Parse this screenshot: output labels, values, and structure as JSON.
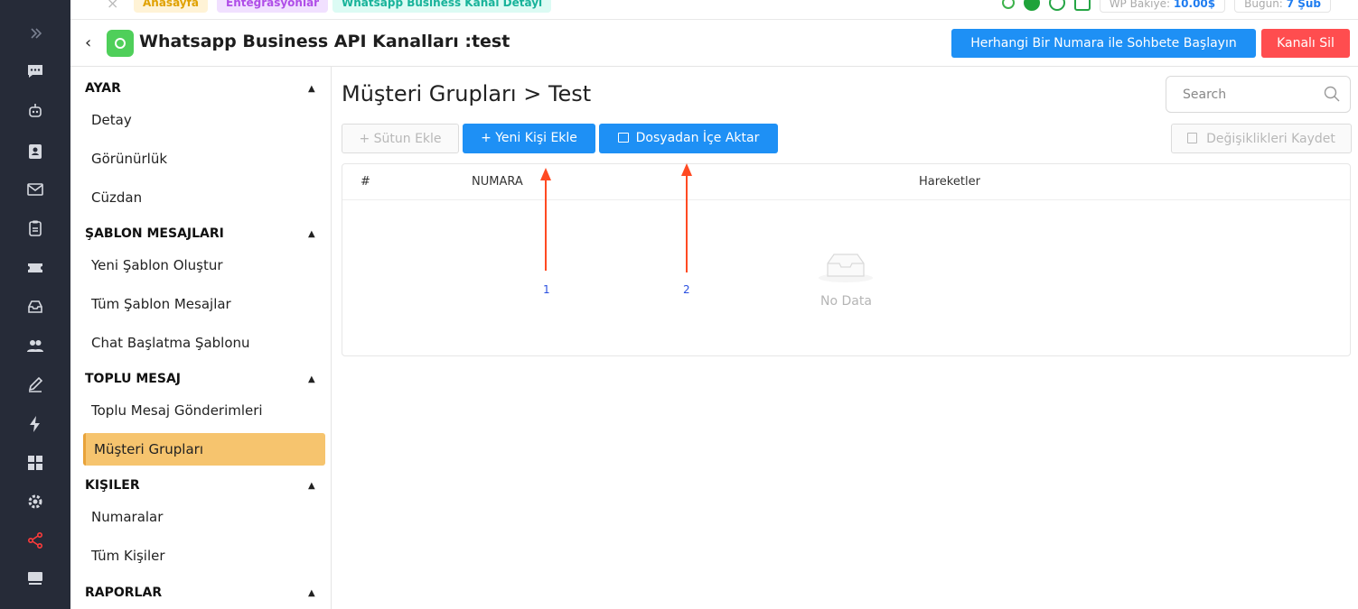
{
  "top": {
    "crumbs": [
      "Anasayfa",
      "Entegrasyonlar",
      "Whatsapp Business Kanal Detayı"
    ],
    "balance_label": "WP Bakiye:",
    "balance_value": "10.00$",
    "date_label": "Bugün:",
    "date_value": "7 Şub"
  },
  "header": {
    "title": "Whatsapp Business API Kanalları :test",
    "start_chat_label": "Herhangi Bir Numara ile Sohbete Başlayın",
    "delete_label": "Kanalı Sil"
  },
  "nav": {
    "sections": [
      {
        "title": "AYAR",
        "items": [
          "Detay",
          "Görünürlük",
          "Cüzdan"
        ]
      },
      {
        "title": "ŞABLON MESAJLARI",
        "items": [
          "Yeni Şablon Oluştur",
          "Tüm Şablon Mesajlar",
          "Chat Başlatma Şablonu"
        ]
      },
      {
        "title": "TOPLU MESAJ",
        "items": [
          "Toplu Mesaj Gönderimleri",
          "Müşteri Grupları"
        ]
      },
      {
        "title": "KIŞILER",
        "items": [
          "Numaralar",
          "Tüm Kişiler"
        ]
      },
      {
        "title": "RAPORLAR",
        "items": []
      }
    ],
    "active_item": "Müşteri Grupları"
  },
  "main": {
    "title": "Müşteri Grupları > Test",
    "search_placeholder": "Search",
    "add_column_label": "+  Sütun Ekle",
    "new_contact_label": "+  Yeni Kişi Ekle",
    "import_label": "Dosyadan İçe Aktar",
    "save_label": "Değişiklikleri Kaydet",
    "columns": [
      "#",
      "NUMARA",
      "Hareketler"
    ],
    "empty_text": "No Data"
  },
  "annotations": {
    "arrow1": "1",
    "arrow2": "2"
  },
  "colors": {
    "primary": "#1e90f5",
    "danger": "#ff4d4f",
    "active_nav": "#f6c46e",
    "rail": "#262b38",
    "arrow": "#ff4a22"
  }
}
